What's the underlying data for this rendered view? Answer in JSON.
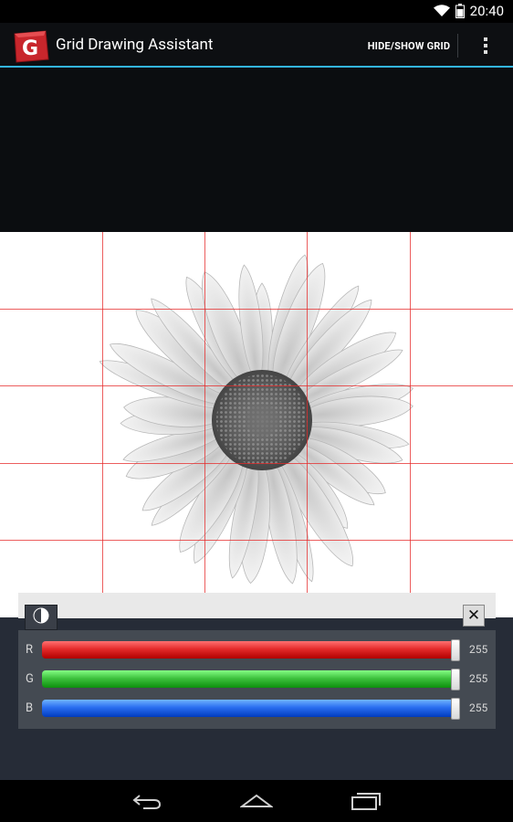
{
  "status_bar": {
    "time": "20:40",
    "wifi_icon": "wifi-icon",
    "battery_icon": "battery-icon"
  },
  "action_bar": {
    "title": "Grid Drawing Assistant",
    "hide_show_label": "HIDE/SHOW GRID",
    "overflow_icon": "overflow-menu-icon",
    "logo_icon": "app-logo-icon"
  },
  "image": {
    "subject": "daisy-flower-image"
  },
  "color_panel": {
    "contrast_icon": "contrast-icon",
    "close_label": "✕",
    "channels": [
      {
        "label": "R",
        "value": "255",
        "level": 1.0,
        "color": "#e42b2b"
      },
      {
        "label": "G",
        "value": "255",
        "level": 1.0,
        "color": "#3fc23f"
      },
      {
        "label": "B",
        "value": "255",
        "level": 1.0,
        "color": "#2a6ef0"
      }
    ]
  },
  "nav_bar": {
    "back_icon": "back-icon",
    "home_icon": "home-icon",
    "recents_icon": "recents-icon"
  },
  "accent_color": "#33b5e5"
}
